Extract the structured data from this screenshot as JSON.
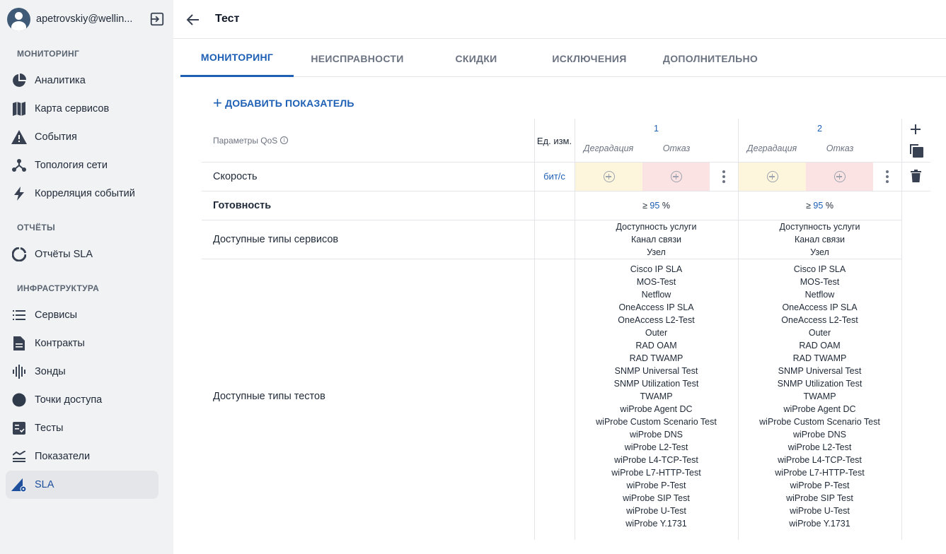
{
  "user": {
    "name": "apetrovskiy@wellin..."
  },
  "sidebar": {
    "sections": [
      {
        "title": "МОНИТОРИНГ",
        "items": [
          {
            "label": "Аналитика",
            "icon": "pie-chart-icon"
          },
          {
            "label": "Карта сервисов",
            "icon": "map-icon"
          },
          {
            "label": "События",
            "icon": "warning-icon"
          },
          {
            "label": "Топология сети",
            "icon": "topology-icon"
          },
          {
            "label": "Корреляция событий",
            "icon": "lightning-icon"
          }
        ]
      },
      {
        "title": "ОТЧЁТЫ",
        "items": [
          {
            "label": "Отчёты SLA",
            "icon": "sla-report-icon"
          }
        ]
      },
      {
        "title": "ИНФРАСТРУКТУРА",
        "items": [
          {
            "label": "Сервисы",
            "icon": "list-icon"
          },
          {
            "label": "Контракты",
            "icon": "document-icon"
          },
          {
            "label": "Зонды",
            "icon": "waveform-icon"
          },
          {
            "label": "Точки доступа",
            "icon": "circle-icon"
          },
          {
            "label": "Тесты",
            "icon": "checklist-icon"
          },
          {
            "label": "Показатели",
            "icon": "indicators-icon"
          },
          {
            "label": "SLA",
            "icon": "sla-icon",
            "active": true
          }
        ]
      }
    ]
  },
  "header": {
    "title": "Тест"
  },
  "tabs": [
    "МОНИТОРИНГ",
    "НЕИСПРАВНОСТИ",
    "СКИДКИ",
    "ИСКЛЮЧЕНИЯ",
    "ДОПОЛНИТЕЛЬНО"
  ],
  "add_indicator": "ДОБАВИТЬ ПОКАЗАТЕЛЬ",
  "table": {
    "qos_header": "Параметры QoS",
    "unit_header": "Ед. изм.",
    "columns": [
      {
        "number": "1",
        "degradation": "Деградация",
        "failure": "Отказ"
      },
      {
        "number": "2",
        "degradation": "Деградация",
        "failure": "Отказ"
      }
    ],
    "rows": {
      "speed": {
        "label": "Скорость",
        "unit": "бит/с"
      },
      "availability": {
        "label": "Готовность",
        "prefix": "≥",
        "value": "95",
        "suffix": "%"
      },
      "service_types": {
        "label": "Доступные типы сервисов",
        "values": [
          "Доступность услуги",
          "Канал связи",
          "Узел"
        ]
      },
      "test_types": {
        "label": "Доступные типы тестов",
        "values": [
          "Cisco IP SLA",
          "MOS-Test",
          "Netflow",
          "OneAccess IP SLA",
          "OneAccess L2-Test",
          "Outer",
          "RAD OAM",
          "RAD TWAMP",
          "SNMP Universal Test",
          "SNMP Utilization Test",
          "TWAMP",
          "wiProbe Agent DC",
          "wiProbe Custom Scenario Test",
          "wiProbe DNS",
          "wiProbe L2-Test",
          "wiProbe L4-TCP-Test",
          "wiProbe L7-HTTP-Test",
          "wiProbe P-Test",
          "wiProbe SIP Test",
          "wiProbe U-Test",
          "wiProbe Y.1731"
        ]
      }
    }
  },
  "colors": {
    "accent": "#1d5fb4",
    "degradation_bg": "#fdf6dc",
    "failure_bg": "#fbe3e3",
    "sidebar_bg": "#f1f2f4"
  }
}
